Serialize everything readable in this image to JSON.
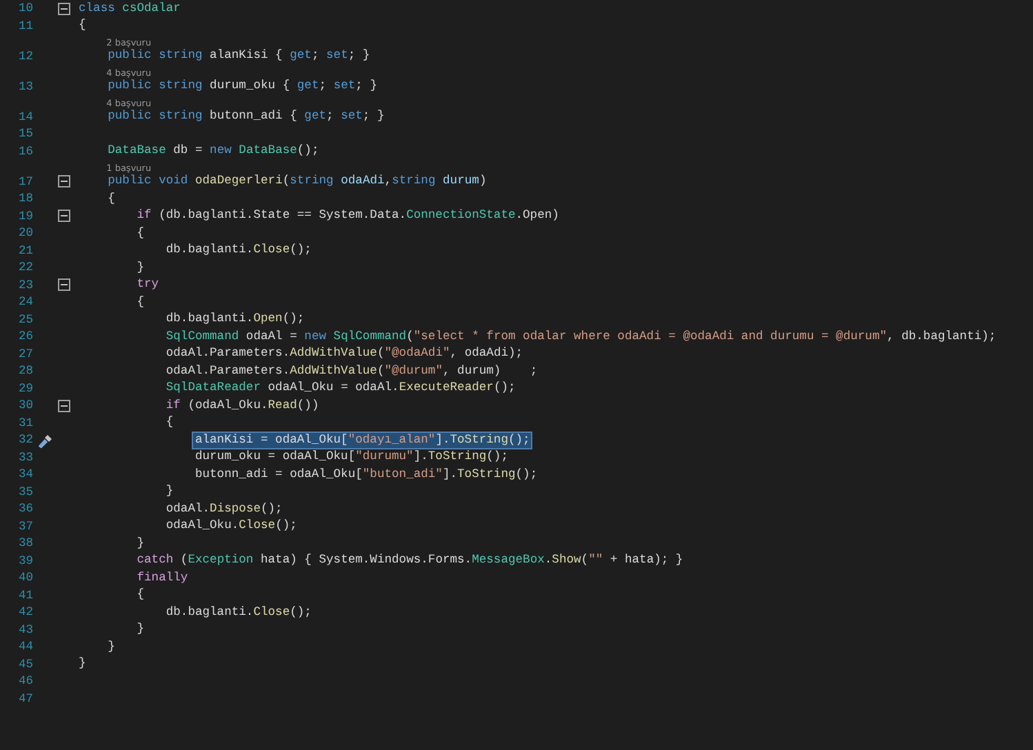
{
  "editor": {
    "lines": [
      {
        "number": "10",
        "fold": true,
        "actions": false,
        "selected": false,
        "tokens": [
          {
            "kind": "kw",
            "text": "class"
          },
          {
            "kind": "type",
            "text": " csOdalar"
          }
        ]
      },
      {
        "number": "11",
        "fold": false,
        "actions": false,
        "selected": false,
        "tokens": [
          {
            "kind": "txt",
            "text": "{"
          }
        ]
      },
      {
        "number": "12",
        "fold": false,
        "actions": false,
        "selected": false,
        "references": "2 başvuru",
        "tokens": [
          {
            "kind": "kw",
            "text": "    public"
          },
          {
            "kind": "kw",
            "text": " string"
          },
          {
            "kind": "txt",
            "text": " alanKisi { "
          },
          {
            "kind": "kw",
            "text": "get"
          },
          {
            "kind": "txt",
            "text": "; "
          },
          {
            "kind": "kw",
            "text": "set"
          },
          {
            "kind": "txt",
            "text": "; }"
          }
        ]
      },
      {
        "number": "13",
        "fold": false,
        "actions": false,
        "selected": false,
        "references": "4 başvuru",
        "tokens": [
          {
            "kind": "kw",
            "text": "    public"
          },
          {
            "kind": "kw",
            "text": " string"
          },
          {
            "kind": "txt",
            "text": " durum_oku { "
          },
          {
            "kind": "kw",
            "text": "get"
          },
          {
            "kind": "txt",
            "text": "; "
          },
          {
            "kind": "kw",
            "text": "set"
          },
          {
            "kind": "txt",
            "text": "; }"
          }
        ]
      },
      {
        "number": "14",
        "fold": false,
        "actions": false,
        "selected": false,
        "references": "4 başvuru",
        "tokens": [
          {
            "kind": "kw",
            "text": "    public"
          },
          {
            "kind": "kw",
            "text": " string"
          },
          {
            "kind": "txt",
            "text": " butonn_adi { "
          },
          {
            "kind": "kw",
            "text": "get"
          },
          {
            "kind": "txt",
            "text": "; "
          },
          {
            "kind": "kw",
            "text": "set"
          },
          {
            "kind": "txt",
            "text": "; }"
          }
        ]
      },
      {
        "number": "15",
        "fold": false,
        "actions": false,
        "selected": false
      },
      {
        "number": "16",
        "fold": false,
        "actions": false,
        "selected": false,
        "tokens": [
          {
            "kind": "type",
            "text": "    DataBase"
          },
          {
            "kind": "txt",
            "text": " db = "
          },
          {
            "kind": "kw",
            "text": "new"
          },
          {
            "kind": "type",
            "text": " DataBase"
          },
          {
            "kind": "txt",
            "text": "();"
          }
        ]
      },
      {
        "number": "17",
        "fold": true,
        "actions": false,
        "selected": false,
        "references": "1 başvuru",
        "tokens": [
          {
            "kind": "kw",
            "text": "    public"
          },
          {
            "kind": "kw",
            "text": " void"
          },
          {
            "kind": "fn",
            "text": " odaDegerleri"
          },
          {
            "kind": "txt",
            "text": "("
          },
          {
            "kind": "kw",
            "text": "string"
          },
          {
            "kind": "param",
            "text": " odaAdi"
          },
          {
            "kind": "txt",
            "text": ","
          },
          {
            "kind": "kw",
            "text": "string"
          },
          {
            "kind": "param",
            "text": " durum"
          },
          {
            "kind": "txt",
            "text": ")"
          }
        ]
      },
      {
        "number": "18",
        "fold": false,
        "actions": false,
        "selected": false,
        "tokens": [
          {
            "kind": "txt",
            "text": "    {"
          }
        ]
      },
      {
        "number": "19",
        "fold": true,
        "actions": false,
        "selected": false,
        "tokens": [
          {
            "kind": "ctl",
            "text": "        if"
          },
          {
            "kind": "txt",
            "text": " (db.baglanti.State == System.Data."
          },
          {
            "kind": "type",
            "text": "ConnectionState"
          },
          {
            "kind": "txt",
            "text": ".Open)"
          }
        ]
      },
      {
        "number": "20",
        "fold": false,
        "actions": false,
        "selected": false,
        "tokens": [
          {
            "kind": "txt",
            "text": "        {"
          }
        ]
      },
      {
        "number": "21",
        "fold": false,
        "actions": false,
        "selected": false,
        "tokens": [
          {
            "kind": "txt",
            "text": "            db.baglanti."
          },
          {
            "kind": "fn",
            "text": "Close"
          },
          {
            "kind": "txt",
            "text": "();"
          }
        ]
      },
      {
        "number": "22",
        "fold": false,
        "actions": false,
        "selected": false,
        "tokens": [
          {
            "kind": "txt",
            "text": "        }"
          }
        ]
      },
      {
        "number": "23",
        "fold": true,
        "actions": false,
        "selected": false,
        "tokens": [
          {
            "kind": "ctl",
            "text": "        try"
          }
        ]
      },
      {
        "number": "24",
        "fold": false,
        "actions": false,
        "selected": false,
        "tokens": [
          {
            "kind": "txt",
            "text": "        {"
          }
        ]
      },
      {
        "number": "25",
        "fold": false,
        "actions": false,
        "selected": false,
        "tokens": [
          {
            "kind": "txt",
            "text": "            db.baglanti."
          },
          {
            "kind": "fn",
            "text": "Open"
          },
          {
            "kind": "txt",
            "text": "();"
          }
        ]
      },
      {
        "number": "26",
        "fold": false,
        "actions": false,
        "selected": false,
        "tokens": [
          {
            "kind": "type",
            "text": "            SqlCommand"
          },
          {
            "kind": "txt",
            "text": " odaAl = "
          },
          {
            "kind": "kw",
            "text": "new"
          },
          {
            "kind": "type",
            "text": " SqlCommand"
          },
          {
            "kind": "txt",
            "text": "("
          },
          {
            "kind": "str",
            "text": "\"select * from odalar where odaAdi = @odaAdi and durumu = @durum\""
          },
          {
            "kind": "txt",
            "text": ", db.baglanti);"
          }
        ]
      },
      {
        "number": "27",
        "fold": false,
        "actions": false,
        "selected": false,
        "tokens": [
          {
            "kind": "txt",
            "text": "            odaAl.Parameters."
          },
          {
            "kind": "fn",
            "text": "AddWithValue"
          },
          {
            "kind": "txt",
            "text": "("
          },
          {
            "kind": "str",
            "text": "\"@odaAdi\""
          },
          {
            "kind": "txt",
            "text": ", odaAdi);"
          }
        ]
      },
      {
        "number": "28",
        "fold": false,
        "actions": false,
        "selected": false,
        "tokens": [
          {
            "kind": "txt",
            "text": "            odaAl.Parameters."
          },
          {
            "kind": "fn",
            "text": "AddWithValue"
          },
          {
            "kind": "txt",
            "text": "("
          },
          {
            "kind": "str",
            "text": "\"@durum\""
          },
          {
            "kind": "txt",
            "text": ", durum)    ;"
          }
        ]
      },
      {
        "number": "29",
        "fold": false,
        "actions": false,
        "selected": false,
        "tokens": [
          {
            "kind": "type",
            "text": "            SqlDataReader"
          },
          {
            "kind": "txt",
            "text": " odaAl_Oku = odaAl."
          },
          {
            "kind": "fn",
            "text": "ExecuteReader"
          },
          {
            "kind": "txt",
            "text": "();"
          }
        ]
      },
      {
        "number": "30",
        "fold": true,
        "actions": false,
        "selected": false,
        "tokens": [
          {
            "kind": "ctl",
            "text": "            if"
          },
          {
            "kind": "txt",
            "text": " (odaAl_Oku."
          },
          {
            "kind": "fn",
            "text": "Read"
          },
          {
            "kind": "txt",
            "text": "())"
          }
        ]
      },
      {
        "number": "31",
        "fold": false,
        "actions": false,
        "selected": false,
        "tokens": [
          {
            "kind": "txt",
            "text": "            {"
          }
        ]
      },
      {
        "number": "32",
        "fold": false,
        "actions": true,
        "selected": true,
        "tokens": [
          {
            "kind": "txt",
            "text": "                alanKisi = odaAl_Oku["
          },
          {
            "kind": "str",
            "text": "\"odayı_alan\""
          },
          {
            "kind": "txt",
            "text": "]."
          },
          {
            "kind": "fn",
            "text": "ToString"
          },
          {
            "kind": "txt",
            "text": "();"
          }
        ]
      },
      {
        "number": "33",
        "fold": false,
        "actions": false,
        "selected": false,
        "tokens": [
          {
            "kind": "txt",
            "text": "                durum_oku = odaAl_Oku["
          },
          {
            "kind": "str",
            "text": "\"durumu\""
          },
          {
            "kind": "txt",
            "text": "]."
          },
          {
            "kind": "fn",
            "text": "ToString"
          },
          {
            "kind": "txt",
            "text": "();"
          }
        ]
      },
      {
        "number": "34",
        "fold": false,
        "actions": false,
        "selected": false,
        "tokens": [
          {
            "kind": "txt",
            "text": "                butonn_adi = odaAl_Oku["
          },
          {
            "kind": "str",
            "text": "\"buton_adi\""
          },
          {
            "kind": "txt",
            "text": "]."
          },
          {
            "kind": "fn",
            "text": "ToString"
          },
          {
            "kind": "txt",
            "text": "();"
          }
        ]
      },
      {
        "number": "35",
        "fold": false,
        "actions": false,
        "selected": false,
        "tokens": [
          {
            "kind": "txt",
            "text": "            }"
          }
        ]
      },
      {
        "number": "36",
        "fold": false,
        "actions": false,
        "selected": false,
        "tokens": [
          {
            "kind": "txt",
            "text": "            odaAl."
          },
          {
            "kind": "fn",
            "text": "Dispose"
          },
          {
            "kind": "txt",
            "text": "();"
          }
        ]
      },
      {
        "number": "37",
        "fold": false,
        "actions": false,
        "selected": false,
        "tokens": [
          {
            "kind": "txt",
            "text": "            odaAl_Oku."
          },
          {
            "kind": "fn",
            "text": "Close"
          },
          {
            "kind": "txt",
            "text": "();"
          }
        ]
      },
      {
        "number": "38",
        "fold": false,
        "actions": false,
        "selected": false,
        "tokens": [
          {
            "kind": "txt",
            "text": "        }"
          }
        ]
      },
      {
        "number": "39",
        "fold": false,
        "actions": false,
        "selected": false,
        "tokens": [
          {
            "kind": "ctl",
            "text": "        catch"
          },
          {
            "kind": "txt",
            "text": " ("
          },
          {
            "kind": "type",
            "text": "Exception"
          },
          {
            "kind": "txt",
            "text": " hata) { System.Windows.Forms."
          },
          {
            "kind": "type",
            "text": "MessageBox"
          },
          {
            "kind": "txt",
            "text": "."
          },
          {
            "kind": "fn",
            "text": "Show"
          },
          {
            "kind": "txt",
            "text": "("
          },
          {
            "kind": "str",
            "text": "\"\""
          },
          {
            "kind": "txt",
            "text": " + hata); }"
          }
        ]
      },
      {
        "number": "40",
        "fold": false,
        "actions": false,
        "selected": false,
        "tokens": [
          {
            "kind": "ctl",
            "text": "        finally"
          }
        ]
      },
      {
        "number": "41",
        "fold": false,
        "actions": false,
        "selected": false,
        "tokens": [
          {
            "kind": "txt",
            "text": "        {"
          }
        ]
      },
      {
        "number": "42",
        "fold": false,
        "actions": false,
        "selected": false,
        "tokens": [
          {
            "kind": "txt",
            "text": "            db.baglanti."
          },
          {
            "kind": "fn",
            "text": "Close"
          },
          {
            "kind": "txt",
            "text": "();"
          }
        ]
      },
      {
        "number": "43",
        "fold": false,
        "actions": false,
        "selected": false,
        "tokens": [
          {
            "kind": "txt",
            "text": "        }"
          }
        ]
      },
      {
        "number": "44",
        "fold": false,
        "actions": false,
        "selected": false,
        "tokens": [
          {
            "kind": "txt",
            "text": "    }"
          }
        ]
      },
      {
        "number": "45",
        "fold": false,
        "actions": false,
        "selected": false,
        "tokens": [
          {
            "kind": "txt",
            "text": "}"
          }
        ]
      },
      {
        "number": "46",
        "fold": false,
        "actions": false,
        "selected": false
      },
      {
        "number": "47",
        "fold": false,
        "actions": false,
        "selected": false
      }
    ]
  }
}
